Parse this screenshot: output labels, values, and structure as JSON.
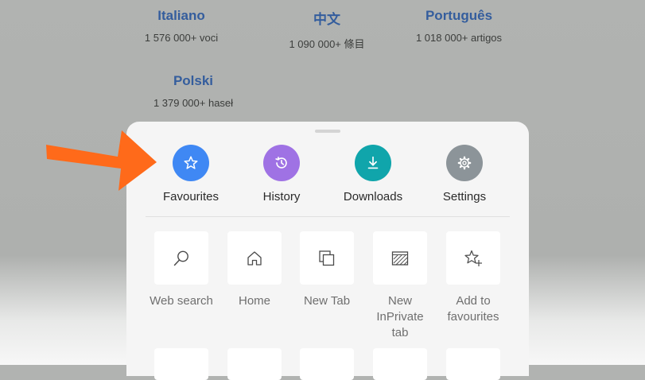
{
  "background_languages": [
    {
      "name": "Italiano",
      "count": "1 576 000+ voci"
    },
    {
      "name": "中文",
      "count": "1 090 000+ 條目"
    },
    {
      "name": "Português",
      "count": "1 018 000+ artigos"
    },
    {
      "name": "Polski",
      "count": "1 379 000+ haseł"
    }
  ],
  "menu": {
    "top_actions": [
      {
        "label": "Favourites",
        "icon": "star-icon",
        "color": "#3f88f4"
      },
      {
        "label": "History",
        "icon": "history-icon",
        "color": "#9f72e4"
      },
      {
        "label": "Downloads",
        "icon": "download-icon",
        "color": "#10a5ab"
      },
      {
        "label": "Settings",
        "icon": "gear-icon",
        "color": "#8c9499"
      }
    ],
    "tiles": [
      {
        "label": "Web search",
        "icon": "search-icon"
      },
      {
        "label": "Home",
        "icon": "home-icon"
      },
      {
        "label": "New Tab",
        "icon": "new-tab-icon"
      },
      {
        "label": "New InPrivate tab",
        "icon": "inprivate-icon"
      },
      {
        "label": "Add to favourites",
        "icon": "add-favourite-icon"
      }
    ]
  },
  "annotation": {
    "arrow_color": "#ff6a1a",
    "points_to": "Favourites"
  }
}
